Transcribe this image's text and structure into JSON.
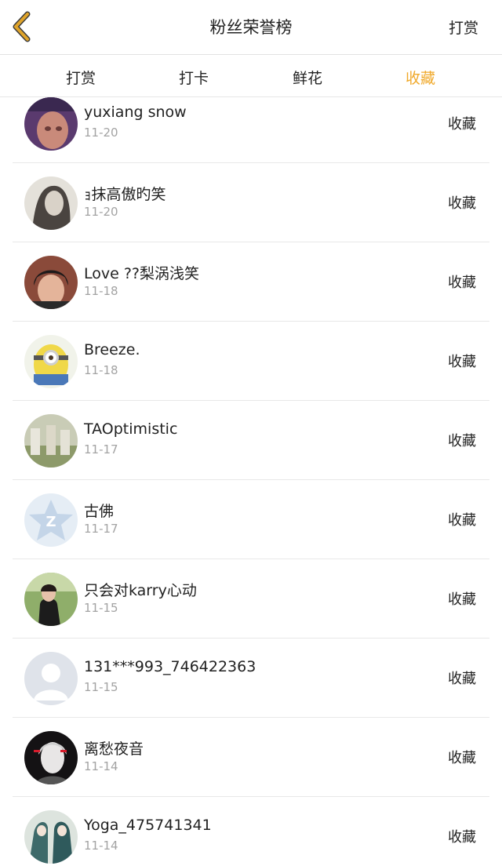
{
  "header": {
    "title": "粉丝荣誉榜",
    "action": "打赏",
    "back_icon": "chevron-left-icon",
    "back_color": "#e0a42a"
  },
  "tabs": [
    {
      "label": "打赏",
      "active": false
    },
    {
      "label": "打卡",
      "active": false
    },
    {
      "label": "鲜花",
      "active": false
    },
    {
      "label": "收藏",
      "active": true
    }
  ],
  "accent_color": "#f0a92b",
  "fans": [
    {
      "name": "yuxiang snow",
      "date": "11-20",
      "action": "收藏",
      "avatar": "photo-avatar"
    },
    {
      "name": "ｮ抹高傲旳笑",
      "date": "11-20",
      "action": "收藏",
      "avatar": "photo-avatar"
    },
    {
      "name": "Love ??梨涡浅笑",
      "date": "11-18",
      "action": "收藏",
      "avatar": "photo-avatar"
    },
    {
      "name": "Breeze.",
      "date": "11-18",
      "action": "收藏",
      "avatar": "minion-avatar"
    },
    {
      "name": "TAOptimistic",
      "date": "11-17",
      "action": "收藏",
      "avatar": "photo-avatar"
    },
    {
      "name": "古佛",
      "date": "11-17",
      "action": "收藏",
      "avatar": "default-z-avatar"
    },
    {
      "name": "只会对karry心动",
      "date": "11-15",
      "action": "收藏",
      "avatar": "photo-avatar"
    },
    {
      "name": "131***993_746422363",
      "date": "11-15",
      "action": "收藏",
      "avatar": "default-person-avatar"
    },
    {
      "name": "离愁夜音",
      "date": "11-14",
      "action": "收藏",
      "avatar": "photo-avatar"
    },
    {
      "name": "Yoga_475741341",
      "date": "11-14",
      "action": "收藏",
      "avatar": "photo-avatar"
    }
  ]
}
